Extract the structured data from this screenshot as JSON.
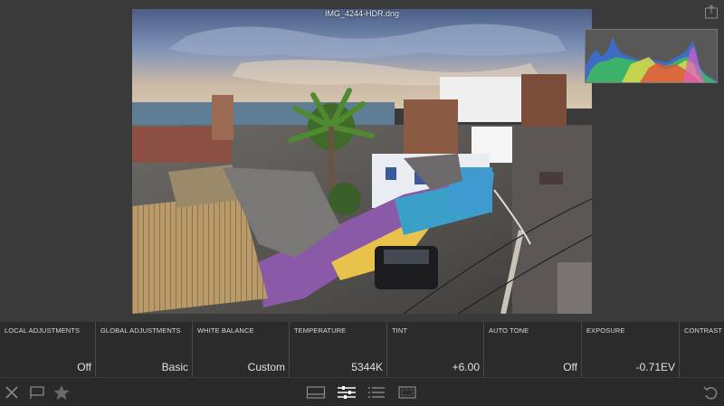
{
  "photo": {
    "filename": "IMG_4244-HDR.dng"
  },
  "histogram": {
    "colors": [
      "#3a6fd8",
      "#d9d94a",
      "#e0503a",
      "#3cc84a"
    ]
  },
  "adjustments": [
    {
      "label": "LOCAL ADJUSTMENTS",
      "value": "Off"
    },
    {
      "label": "GLOBAL ADJUSTMENTS",
      "value": "Basic"
    },
    {
      "label": "WHITE BALANCE",
      "value": "Custom"
    },
    {
      "label": "TEMPERATURE",
      "value": "5344K"
    },
    {
      "label": "TINT",
      "value": "+6.00"
    },
    {
      "label": "AUTO TONE",
      "value": "Off"
    },
    {
      "label": "EXPOSURE",
      "value": "-0.71EV"
    },
    {
      "label": "CONTRAST",
      "value": ""
    }
  ],
  "toolbar": {
    "left_icons": [
      "reject-icon",
      "flag-icon",
      "star-icon"
    ],
    "center_icons": [
      "filmstrip-icon",
      "adjustments-icon",
      "metadata-icon",
      "crop-icon"
    ],
    "right_icons": [
      "undo-icon"
    ],
    "active_color": "#ffffff",
    "inactive_color": "#8a8a8a"
  }
}
